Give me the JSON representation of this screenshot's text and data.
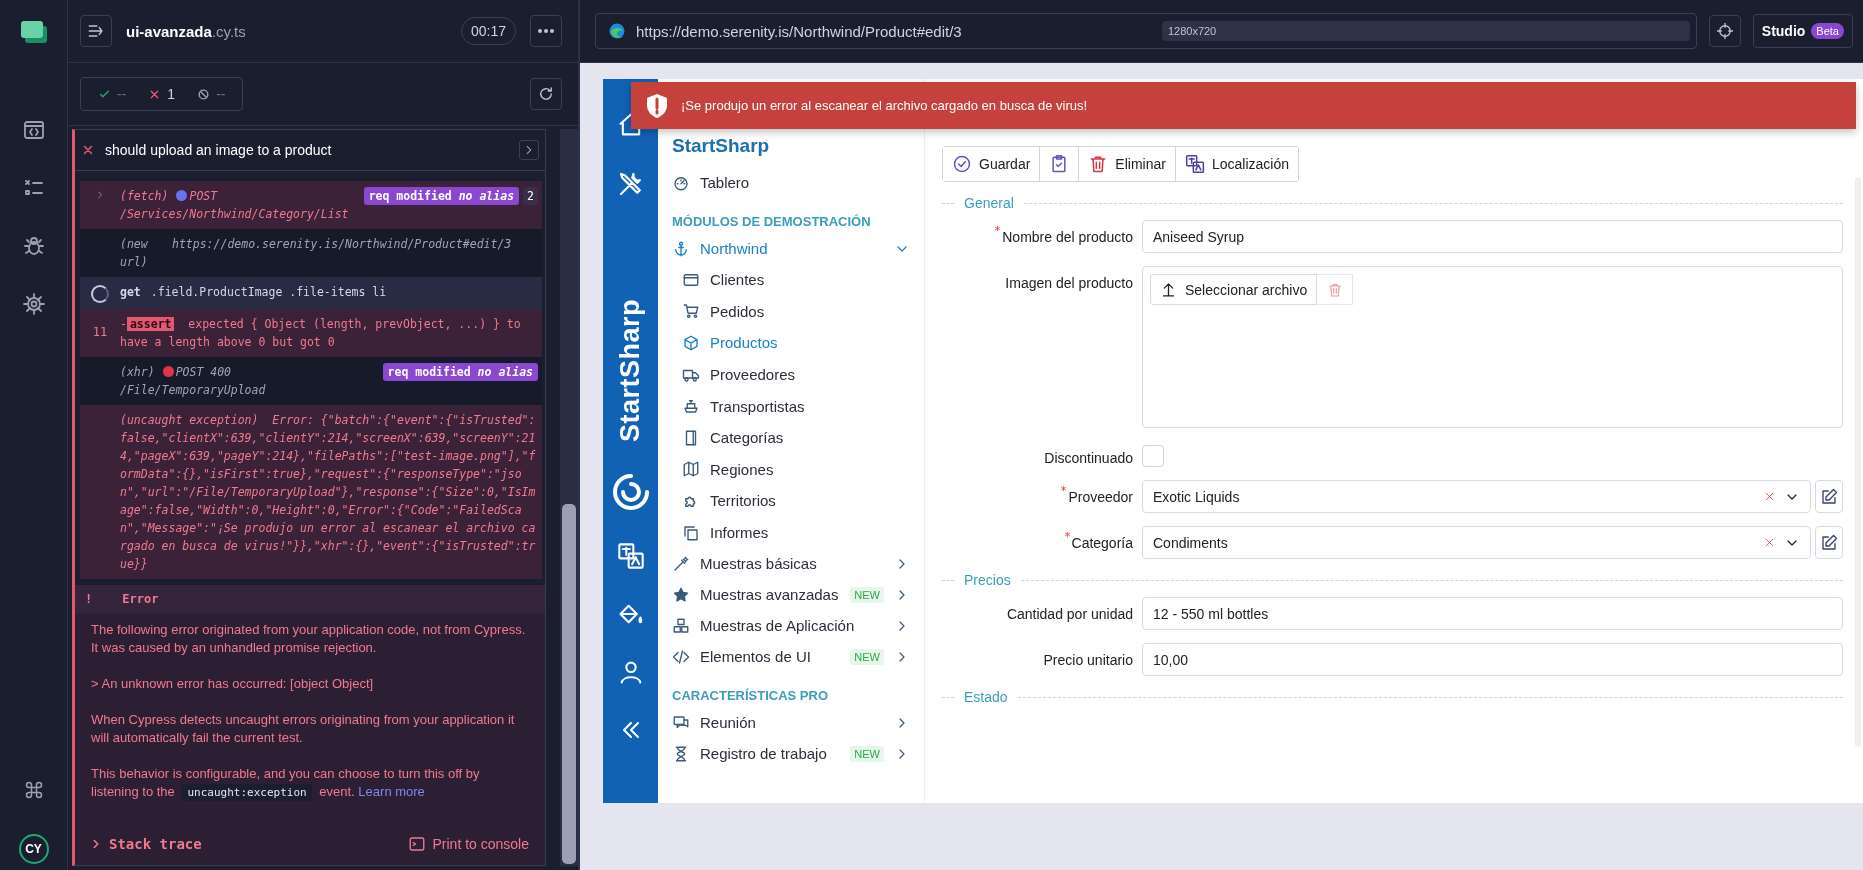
{
  "cypress": {
    "user_initials": "CY",
    "spec": {
      "name": "ui-avanzada",
      "extension": ".cy.ts"
    },
    "timer": "00:17",
    "stats": [
      {
        "kind": "passed",
        "count": "--"
      },
      {
        "kind": "failed",
        "count": "1"
      },
      {
        "kind": "pending",
        "count": "--"
      }
    ],
    "test": {
      "title": "should upload an image to a product",
      "failed": true
    },
    "log": [
      {
        "kind": "request",
        "failed": true,
        "active": false,
        "label": "(fetch)",
        "color": "#6a70f2",
        "method": "POST",
        "url": "/Services/Northwind/Category/List",
        "badge": "req modified *no alias*",
        "count": "2"
      },
      {
        "kind": "event",
        "failed": false,
        "active": false,
        "label": "(new url)",
        "message": "https://demo.serenity.is/Northwind/Product#edit/3"
      },
      {
        "kind": "command",
        "failed": false,
        "active": true,
        "name": "get",
        "message": ".field.ProductImage .file-items li"
      },
      {
        "kind": "assert",
        "failed": true,
        "active": false,
        "number": "11",
        "prefix": "-",
        "name": "assert",
        "message": "expected { Object (length, prevObject, ...) } to have a length above 0 but got 0"
      },
      {
        "kind": "request",
        "failed": false,
        "active": false,
        "label": "(xhr)",
        "color": "#e0344a",
        "method": "POST 400",
        "url": "/File/TemporaryUpload",
        "badge": "req modified *no alias*"
      },
      {
        "kind": "exception",
        "failed": true,
        "active": false,
        "label": "(uncaught exception)",
        "message": "Error: {\"batch\":{\"event\":{\"isTrusted\":false,\"clientX\":639,\"clientY\":214,\"screenX\":639,\"screenY\":214,\"pageX\":639,\"pageY\":214},\"filePaths\":[\"test-image.png\"],\"formData\":{},\"isFirst\":true},\"request\":{\"responseType\":\"json\",\"url\":\"/File/TemporaryUpload\"},\"response\":{\"Size\":0,\"IsImage\":false,\"Width\":0,\"Height\":0,\"Error\":{\"Code\":\"FailedScan\",\"Message\":\"¡Se produjo un error al escanear el archivo cargado en busca de virus!\"}},\"xhr\":{},\"event\":{\"isTrusted\":true}}"
      }
    ],
    "error": {
      "icon": "!",
      "title": "Error",
      "paragraphs": [
        [
          {
            "kind": "text",
            "text": "The following error originated from your application code, not from Cypress. It was caused by an unhandled promise rejection."
          }
        ],
        [
          {
            "kind": "text",
            "text": "> An unknown error has occurred: [object Object]"
          }
        ],
        [
          {
            "kind": "text",
            "text": "When Cypress detects uncaught errors originating from your application it will automatically fail the current test."
          }
        ],
        [
          {
            "kind": "text",
            "text": "This behavior is configurable, and you can choose to turn this off by listening to the"
          },
          {
            "kind": "code",
            "text": "uncaught:exception"
          },
          {
            "kind": "text",
            "text": "event."
          },
          {
            "kind": "link",
            "text": "Learn more"
          }
        ]
      ],
      "stack_trace": "Stack trace",
      "print_button": "Print to console"
    }
  },
  "browser": {
    "url": "https://demo.serenity.is/Northwind/Product#edit/3",
    "viewport": "1280x720",
    "studio": "Studio",
    "studio_badge": "Beta"
  },
  "app": {
    "toast": {
      "kind": "error",
      "message": "¡Se produjo un error al escanear el archivo cargado en busca de virus!"
    },
    "rail_brand": "StartSharp",
    "brand": "StartSharp",
    "nav": [
      {
        "kind": "item",
        "label": "Tablero"
      },
      {
        "kind": "header",
        "label": "MÓDULOS DE DEMOSTRACIÓN"
      },
      {
        "kind": "group",
        "label": "Northwind",
        "expanded": true,
        "children": [
          {
            "label": "Clientes",
            "selected": false
          },
          {
            "label": "Pedidos",
            "selected": false
          },
          {
            "label": "Productos",
            "selected": true
          },
          {
            "label": "Proveedores",
            "selected": false
          },
          {
            "label": "Transportistas",
            "selected": false
          },
          {
            "label": "Categorías",
            "selected": false
          },
          {
            "label": "Regiones",
            "selected": false
          },
          {
            "label": "Territorios",
            "selected": false
          },
          {
            "label": "Informes",
            "selected": false
          }
        ]
      },
      {
        "kind": "group",
        "label": "Muestras básicas",
        "expanded": false
      },
      {
        "kind": "group",
        "label": "Muestras avanzadas",
        "expanded": false,
        "badge": "NEW"
      },
      {
        "kind": "group",
        "label": "Muestras de Aplicación",
        "expanded": false
      },
      {
        "kind": "group",
        "label": "Elementos de UI",
        "expanded": false,
        "badge": "NEW"
      },
      {
        "kind": "header",
        "label": "CARACTERÍSTICAS PRO"
      },
      {
        "kind": "group",
        "label": "Reunión",
        "expanded": false
      },
      {
        "kind": "group",
        "label": "Registro de trabajo",
        "expanded": false,
        "badge": "NEW"
      }
    ],
    "toolbar": [
      {
        "kind": "save",
        "label": "Guardar"
      },
      {
        "kind": "apply"
      },
      {
        "kind": "delete",
        "label": "Eliminar"
      },
      {
        "kind": "localize",
        "label": "Localización"
      }
    ],
    "sections": [
      {
        "title": "General",
        "fields": [
          {
            "kind": "text",
            "label": "Nombre del producto",
            "required": true,
            "value": "Aniseed Syrup"
          },
          {
            "kind": "image",
            "label": "Imagen del producto",
            "required": false,
            "button": "Seleccionar archivo"
          },
          {
            "kind": "checkbox",
            "label": "Discontinuado",
            "required": false,
            "checked": false
          },
          {
            "kind": "select",
            "label": "Proveedor",
            "required": true,
            "value": "Exotic Liquids"
          },
          {
            "kind": "select",
            "label": "Categoría",
            "required": true,
            "value": "Condiments"
          }
        ]
      },
      {
        "title": "Precios",
        "fields": [
          {
            "kind": "text",
            "label": "Cantidad por unidad",
            "required": false,
            "value": "12 - 550 ml bottles"
          },
          {
            "kind": "text",
            "label": "Precio unitario",
            "required": false,
            "value": "10,00"
          }
        ]
      },
      {
        "title": "Estado"
      }
    ]
  }
}
